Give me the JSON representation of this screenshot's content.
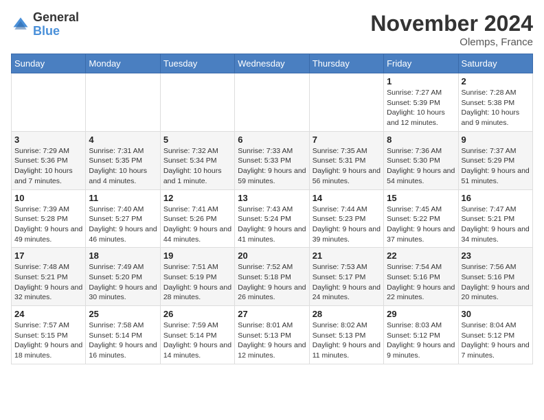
{
  "header": {
    "logo_general": "General",
    "logo_blue": "Blue",
    "month_title": "November 2024",
    "location": "Olemps, France"
  },
  "days_of_week": [
    "Sunday",
    "Monday",
    "Tuesday",
    "Wednesday",
    "Thursday",
    "Friday",
    "Saturday"
  ],
  "weeks": [
    [
      {
        "day": "",
        "info": ""
      },
      {
        "day": "",
        "info": ""
      },
      {
        "day": "",
        "info": ""
      },
      {
        "day": "",
        "info": ""
      },
      {
        "day": "",
        "info": ""
      },
      {
        "day": "1",
        "info": "Sunrise: 7:27 AM\nSunset: 5:39 PM\nDaylight: 10 hours and 12 minutes."
      },
      {
        "day": "2",
        "info": "Sunrise: 7:28 AM\nSunset: 5:38 PM\nDaylight: 10 hours and 9 minutes."
      }
    ],
    [
      {
        "day": "3",
        "info": "Sunrise: 7:29 AM\nSunset: 5:36 PM\nDaylight: 10 hours and 7 minutes."
      },
      {
        "day": "4",
        "info": "Sunrise: 7:31 AM\nSunset: 5:35 PM\nDaylight: 10 hours and 4 minutes."
      },
      {
        "day": "5",
        "info": "Sunrise: 7:32 AM\nSunset: 5:34 PM\nDaylight: 10 hours and 1 minute."
      },
      {
        "day": "6",
        "info": "Sunrise: 7:33 AM\nSunset: 5:33 PM\nDaylight: 9 hours and 59 minutes."
      },
      {
        "day": "7",
        "info": "Sunrise: 7:35 AM\nSunset: 5:31 PM\nDaylight: 9 hours and 56 minutes."
      },
      {
        "day": "8",
        "info": "Sunrise: 7:36 AM\nSunset: 5:30 PM\nDaylight: 9 hours and 54 minutes."
      },
      {
        "day": "9",
        "info": "Sunrise: 7:37 AM\nSunset: 5:29 PM\nDaylight: 9 hours and 51 minutes."
      }
    ],
    [
      {
        "day": "10",
        "info": "Sunrise: 7:39 AM\nSunset: 5:28 PM\nDaylight: 9 hours and 49 minutes."
      },
      {
        "day": "11",
        "info": "Sunrise: 7:40 AM\nSunset: 5:27 PM\nDaylight: 9 hours and 46 minutes."
      },
      {
        "day": "12",
        "info": "Sunrise: 7:41 AM\nSunset: 5:26 PM\nDaylight: 9 hours and 44 minutes."
      },
      {
        "day": "13",
        "info": "Sunrise: 7:43 AM\nSunset: 5:24 PM\nDaylight: 9 hours and 41 minutes."
      },
      {
        "day": "14",
        "info": "Sunrise: 7:44 AM\nSunset: 5:23 PM\nDaylight: 9 hours and 39 minutes."
      },
      {
        "day": "15",
        "info": "Sunrise: 7:45 AM\nSunset: 5:22 PM\nDaylight: 9 hours and 37 minutes."
      },
      {
        "day": "16",
        "info": "Sunrise: 7:47 AM\nSunset: 5:21 PM\nDaylight: 9 hours and 34 minutes."
      }
    ],
    [
      {
        "day": "17",
        "info": "Sunrise: 7:48 AM\nSunset: 5:21 PM\nDaylight: 9 hours and 32 minutes."
      },
      {
        "day": "18",
        "info": "Sunrise: 7:49 AM\nSunset: 5:20 PM\nDaylight: 9 hours and 30 minutes."
      },
      {
        "day": "19",
        "info": "Sunrise: 7:51 AM\nSunset: 5:19 PM\nDaylight: 9 hours and 28 minutes."
      },
      {
        "day": "20",
        "info": "Sunrise: 7:52 AM\nSunset: 5:18 PM\nDaylight: 9 hours and 26 minutes."
      },
      {
        "day": "21",
        "info": "Sunrise: 7:53 AM\nSunset: 5:17 PM\nDaylight: 9 hours and 24 minutes."
      },
      {
        "day": "22",
        "info": "Sunrise: 7:54 AM\nSunset: 5:16 PM\nDaylight: 9 hours and 22 minutes."
      },
      {
        "day": "23",
        "info": "Sunrise: 7:56 AM\nSunset: 5:16 PM\nDaylight: 9 hours and 20 minutes."
      }
    ],
    [
      {
        "day": "24",
        "info": "Sunrise: 7:57 AM\nSunset: 5:15 PM\nDaylight: 9 hours and 18 minutes."
      },
      {
        "day": "25",
        "info": "Sunrise: 7:58 AM\nSunset: 5:14 PM\nDaylight: 9 hours and 16 minutes."
      },
      {
        "day": "26",
        "info": "Sunrise: 7:59 AM\nSunset: 5:14 PM\nDaylight: 9 hours and 14 minutes."
      },
      {
        "day": "27",
        "info": "Sunrise: 8:01 AM\nSunset: 5:13 PM\nDaylight: 9 hours and 12 minutes."
      },
      {
        "day": "28",
        "info": "Sunrise: 8:02 AM\nSunset: 5:13 PM\nDaylight: 9 hours and 11 minutes."
      },
      {
        "day": "29",
        "info": "Sunrise: 8:03 AM\nSunset: 5:12 PM\nDaylight: 9 hours and 9 minutes."
      },
      {
        "day": "30",
        "info": "Sunrise: 8:04 AM\nSunset: 5:12 PM\nDaylight: 9 hours and 7 minutes."
      }
    ]
  ]
}
